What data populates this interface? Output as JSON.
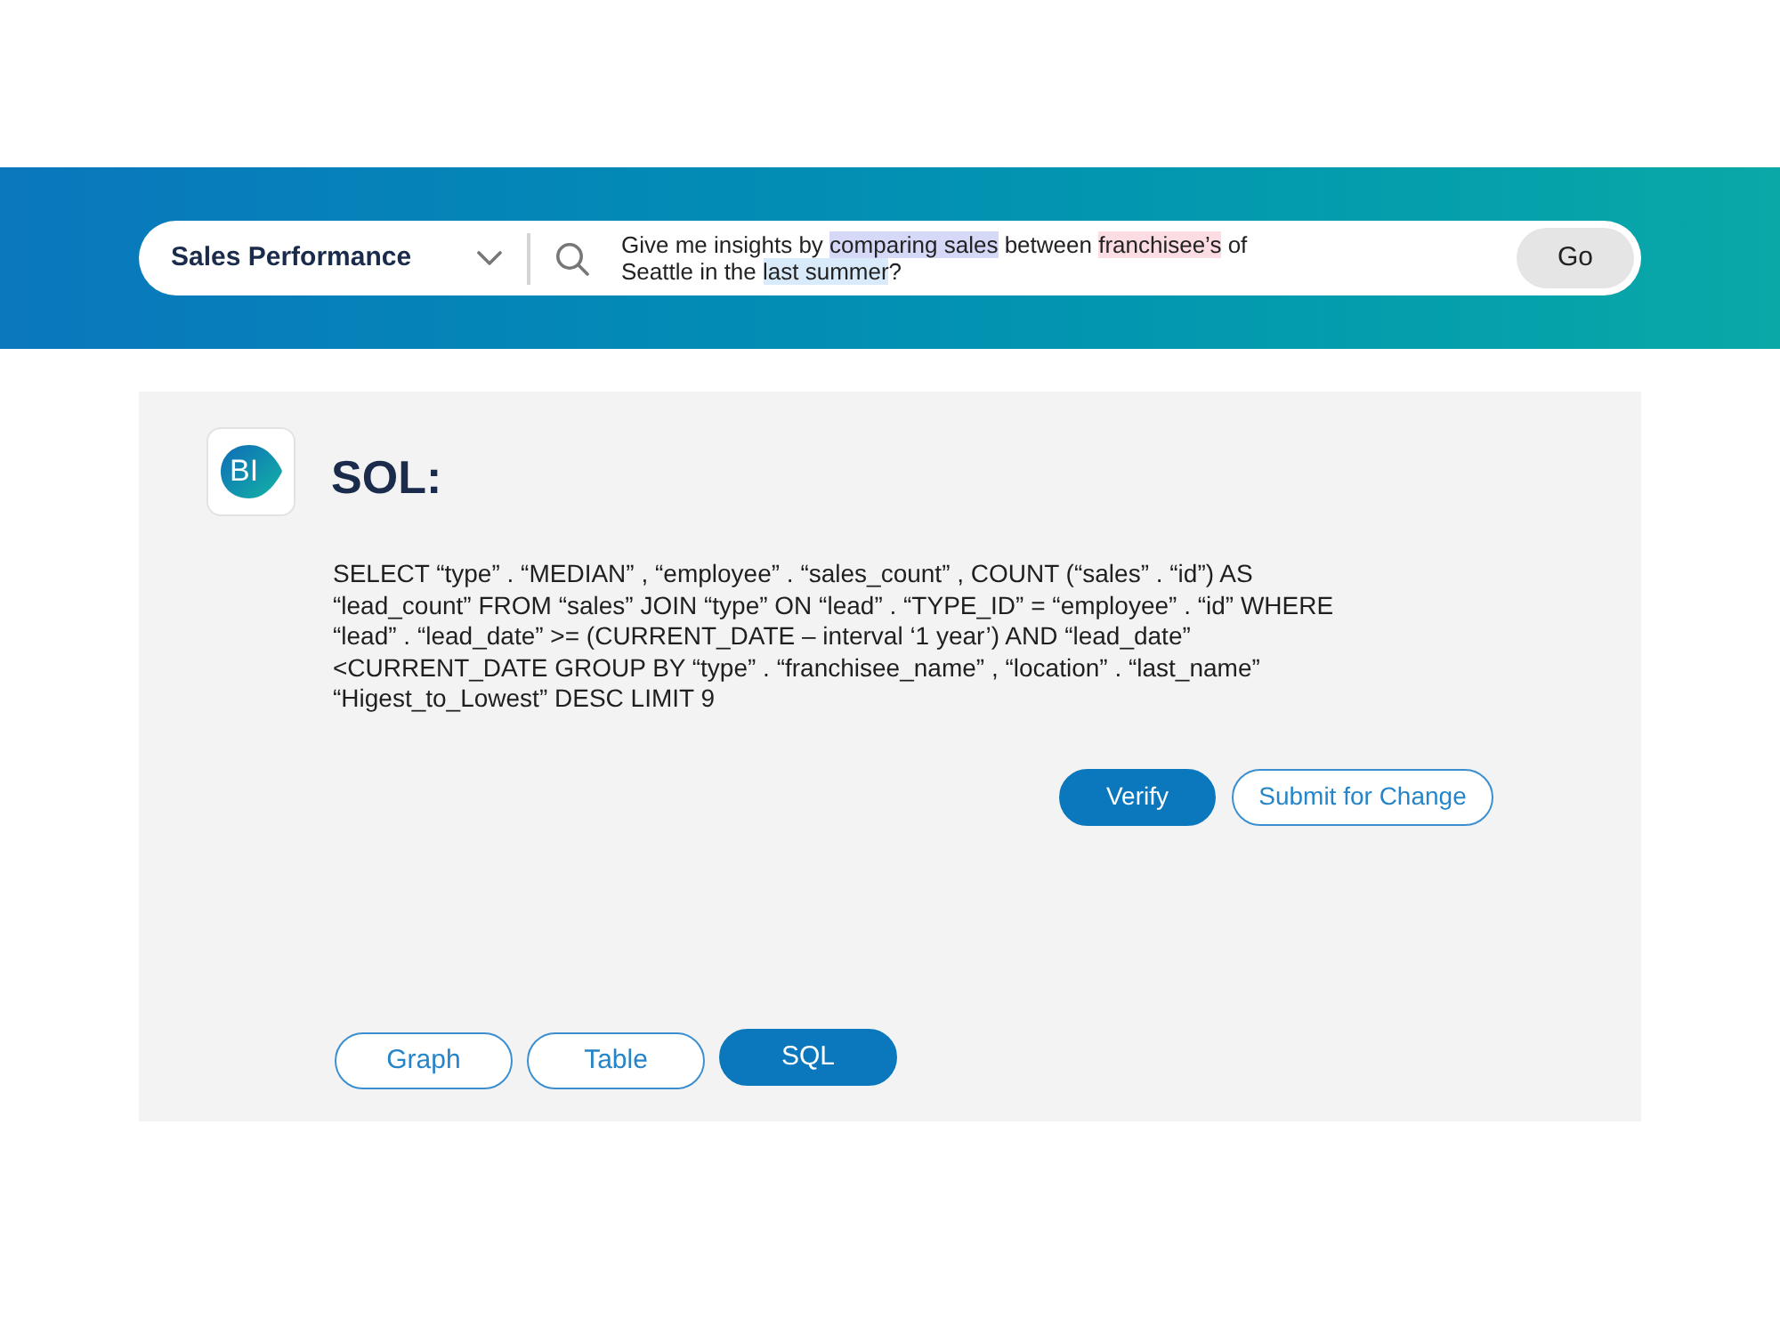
{
  "search": {
    "dataset": "Sales Performance",
    "query": [
      {
        "text": "Give me insights by "
      },
      {
        "text": "comparing sales",
        "color": "#d5d8f6"
      },
      {
        "text": " between "
      },
      {
        "text": "franchisee’s",
        "color": "#fbdde3"
      },
      {
        "text": " of\nSeattle in the "
      },
      {
        "text": "last summer",
        "color": "#d9eafa"
      },
      {
        "text": "?"
      }
    ],
    "button": "Go"
  },
  "result": {
    "logo": "BI",
    "title": "SOL:",
    "sql": "SELECT “type” . “MEDIAN” , “employee” . “sales_count” , COUNT (“sales” . “id”) AS\n“lead_count” FROM “sales” JOIN “type” ON “lead” . “TYPE_ID” = “employee” . “id” WHERE\n“lead” . “lead_date” >= (CURRENT_DATE – interval ‘1 year’) AND “lead_date”\n<CURRENT_DATE GROUP BY “type” . “franchisee_name” , “location” . “last_name”\n“Higest_to_Lowest” DESC LIMIT 9",
    "actions": [
      {
        "label": "Verify",
        "kind": "primary"
      },
      {
        "label": "Submit for Change",
        "kind": "secondary"
      }
    ]
  },
  "tabs": [
    {
      "label": "Graph",
      "selected": false
    },
    {
      "label": "Table",
      "selected": false
    },
    {
      "label": "SQL",
      "selected": true
    }
  ]
}
